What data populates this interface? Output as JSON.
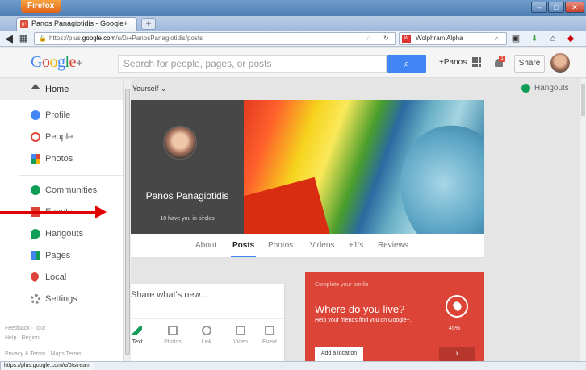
{
  "browser": {
    "menu_label": "Firefox",
    "tab_title": "Panos Panagiotidis - Google+",
    "new_tab": "+",
    "url_prefix": "https://plus.",
    "url_domain": "google.com",
    "url_path": "/u/0/+PanosPanagiotidis/posts",
    "search_engine_text": "Wolphram Alpha",
    "status_url": "https://plus.google.com/u/0/stream",
    "window_controls": [
      "–",
      "□",
      "✕"
    ]
  },
  "gplus": {
    "logo": "Google+",
    "search_placeholder": "Search for people, pages, or posts",
    "search_button": "🔍",
    "plus_name": "+Panos",
    "notification_count": "1",
    "share_button": "Share"
  },
  "sidebar": {
    "items": [
      {
        "label": "Home",
        "icon": "home-icon",
        "color": "#555555"
      },
      {
        "label": "Profile",
        "icon": "profile-icon",
        "color": "#4285f4"
      },
      {
        "label": "People",
        "icon": "people-icon",
        "color": "#db4437"
      },
      {
        "label": "Photos",
        "icon": "photos-icon",
        "color": "#f4b400"
      },
      {
        "label": "Communities",
        "icon": "communities-icon",
        "color": "#0f9d58"
      },
      {
        "label": "Events",
        "icon": "events-icon",
        "color": "#db4437"
      },
      {
        "label": "Hangouts",
        "icon": "hangouts-icon",
        "color": "#0f9d58"
      },
      {
        "label": "Pages",
        "icon": "pages-icon",
        "color": "#4285f4"
      },
      {
        "label": "Local",
        "icon": "local-icon",
        "color": "#db4437"
      },
      {
        "label": "Settings",
        "icon": "settings-icon",
        "color": "#888888"
      }
    ],
    "footer_line1": "Feedback · Tour",
    "footer_line2": "Help · Region",
    "footer_line3": "Privacy & Terms · Maps Terms"
  },
  "main": {
    "audience": "Yourself ⌄",
    "hangouts": "Hangouts",
    "profile_name": "Panos Panagiotidis",
    "circles_text": "10 have you in circles",
    "tabs": [
      "About",
      "Posts",
      "Photos",
      "Videos",
      "+1's",
      "Reviews"
    ],
    "active_tab": "Posts",
    "share_placeholder": "Share what's new...",
    "share_options": [
      "Text",
      "Photos",
      "Link",
      "Video",
      "Event"
    ],
    "promo": {
      "eyebrow": "Complete your profile",
      "headline": "Where do you live?",
      "subtext": "Help your friends find you on Google+.",
      "progress": "45%",
      "add_button": "Add a location",
      "next_button": "›"
    }
  }
}
